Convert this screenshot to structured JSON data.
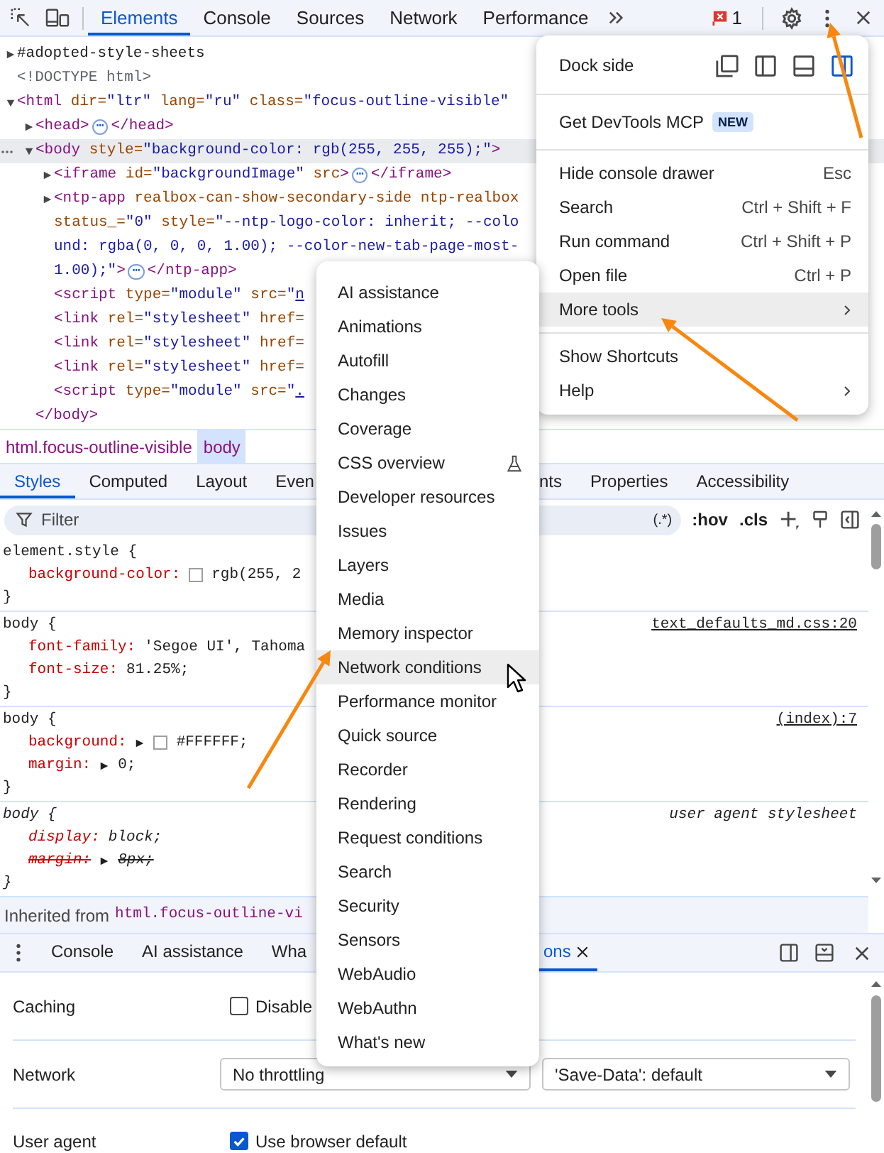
{
  "toolbar": {
    "tabs": [
      {
        "label": "Elements",
        "selected": true
      },
      {
        "label": "Console",
        "selected": false
      },
      {
        "label": "Sources",
        "selected": false
      },
      {
        "label": "Network",
        "selected": false
      },
      {
        "label": "Performance",
        "selected": false
      }
    ],
    "issues_count": "1"
  },
  "dom_tree": [
    {
      "lines": [
        [
          {
            "kind": "pseudo",
            "text": "#adopted-style-sheets"
          }
        ]
      ],
      "expanded": false,
      "selected": false
    },
    {
      "lines": [
        [
          {
            "kind": "doctype",
            "text": "<!DOCTYPE html>"
          }
        ]
      ],
      "selected": false
    },
    {
      "lines": [
        [
          {
            "kind": "tag",
            "text": "<html"
          },
          {
            "kind": "attr",
            "text": " dir="
          },
          {
            "kind": "value",
            "text": "\"ltr\""
          },
          {
            "kind": "attr",
            "text": " lang="
          },
          {
            "kind": "value",
            "text": "\"ru\""
          },
          {
            "kind": "attr",
            "text": " class="
          },
          {
            "kind": "value",
            "text": "\"focus-outline-visible\""
          }
        ]
      ],
      "expanded": true,
      "selected": false,
      "children": [
        {
          "lines": [
            [
              {
                "kind": "tag",
                "text": "<head>"
              },
              {
                "kind": "ellipsis",
                "text": "⋯"
              },
              {
                "kind": "tag",
                "text": "</head>"
              }
            ]
          ],
          "expanded": false,
          "selected": false
        },
        {
          "lines": [
            [
              {
                "kind": "tag",
                "text": "<body"
              },
              {
                "kind": "attr",
                "text": " style="
              },
              {
                "kind": "value",
                "text": "\"background-color: rgb(255, 255, 255);\""
              },
              {
                "kind": "tag",
                "text": ">"
              }
            ]
          ],
          "expanded": true,
          "selected": true,
          "children": [
            {
              "lines": [
                [
                  {
                    "kind": "tag",
                    "text": "<iframe"
                  },
                  {
                    "kind": "attr",
                    "text": " id="
                  },
                  {
                    "kind": "value",
                    "text": "\"backgroundImage\""
                  },
                  {
                    "kind": "attr",
                    "text": " src"
                  },
                  {
                    "kind": "tag",
                    "text": ">"
                  },
                  {
                    "kind": "ellipsis",
                    "text": "⋯"
                  },
                  {
                    "kind": "tag",
                    "text": "</iframe>"
                  }
                ]
              ],
              "expanded": false,
              "selected": false
            },
            {
              "lines": [
                [
                  {
                    "kind": "tag",
                    "text": "<ntp-app"
                  },
                  {
                    "kind": "attr",
                    "text": " realbox-can-show-secondary-side ntp-realbox"
                  }
                ],
                [
                  {
                    "kind": "attr",
                    "text": "status_="
                  },
                  {
                    "kind": "value",
                    "text": "\"0\""
                  },
                  {
                    "kind": "attr",
                    "text": " style="
                  },
                  {
                    "kind": "value",
                    "text": "\"--ntp-logo-color: inherit; --colo"
                  }
                ],
                [
                  {
                    "kind": "value",
                    "text": "und: rgba(0, 0, 0, 1.00); --color-new-tab-page-most-"
                  }
                ],
                [
                  {
                    "kind": "value",
                    "text": "1.00);\""
                  },
                  {
                    "kind": "tag",
                    "text": ">"
                  },
                  {
                    "kind": "ellipsis",
                    "text": "⋯"
                  },
                  {
                    "kind": "tag",
                    "text": "</ntp-app>"
                  }
                ]
              ],
              "expanded": false,
              "selected": false
            },
            {
              "lines": [
                [
                  {
                    "kind": "tag",
                    "text": "<script"
                  },
                  {
                    "kind": "attr",
                    "text": " type="
                  },
                  {
                    "kind": "value",
                    "text": "\"module\""
                  },
                  {
                    "kind": "attr",
                    "text": " src="
                  },
                  {
                    "kind": "value",
                    "text": "\""
                  },
                  {
                    "kind": "link",
                    "text": "n"
                  }
                ]
              ],
              "selected": false
            },
            {
              "lines": [
                [
                  {
                    "kind": "tag",
                    "text": "<link"
                  },
                  {
                    "kind": "attr",
                    "text": " rel="
                  },
                  {
                    "kind": "value",
                    "text": "\"stylesheet\""
                  },
                  {
                    "kind": "attr",
                    "text": " href="
                  }
                ]
              ],
              "selected": false
            },
            {
              "lines": [
                [
                  {
                    "kind": "tag",
                    "text": "<link"
                  },
                  {
                    "kind": "attr",
                    "text": " rel="
                  },
                  {
                    "kind": "value",
                    "text": "\"stylesheet\""
                  },
                  {
                    "kind": "attr",
                    "text": " href="
                  }
                ]
              ],
              "selected": false
            },
            {
              "lines": [
                [
                  {
                    "kind": "tag",
                    "text": "<link"
                  },
                  {
                    "kind": "attr",
                    "text": " rel="
                  },
                  {
                    "kind": "value",
                    "text": "\"stylesheet\""
                  },
                  {
                    "kind": "attr",
                    "text": " href="
                  }
                ]
              ],
              "selected": false
            },
            {
              "lines": [
                [
                  {
                    "kind": "tag",
                    "text": "<script"
                  },
                  {
                    "kind": "attr",
                    "text": " type="
                  },
                  {
                    "kind": "value",
                    "text": "\"module\""
                  },
                  {
                    "kind": "attr",
                    "text": " src="
                  },
                  {
                    "kind": "value",
                    "text": "\""
                  },
                  {
                    "kind": "link",
                    "text": "."
                  }
                ]
              ],
              "selected": false
            }
          ],
          "closing": [
            {
              "kind": "tag",
              "text": "</body>"
            }
          ]
        }
      ]
    }
  ],
  "breadcrumbs": [
    {
      "label": "html.focus-outline-visible",
      "selected": false
    },
    {
      "label": "body",
      "selected": true
    }
  ],
  "styles_tabs": [
    {
      "label": "Styles",
      "selected": true
    },
    {
      "label": "Computed",
      "selected": false
    },
    {
      "label": "Layout",
      "selected": false
    },
    {
      "label": "Even",
      "selected": false
    },
    {
      "label": "nts",
      "selected": false
    },
    {
      "label": "Properties",
      "selected": false
    },
    {
      "label": "Accessibility",
      "selected": false
    }
  ],
  "filter": {
    "placeholder": "Filter",
    "tools": [
      "(.*)",
      ":hov",
      ".cls"
    ]
  },
  "rules": [
    {
      "selector": "element.style {",
      "user_agent": false,
      "declarations": [
        {
          "name": "background-color:",
          "value": "rgb(255, 2",
          "swatch": true,
          "expandable": false,
          "struck": false
        }
      ],
      "closing": "}"
    },
    {
      "selector": "body {",
      "source": "text_defaults_md.css:20",
      "user_agent": false,
      "declarations": [
        {
          "name": "font-family:",
          "value": "'Segoe UI', Tahoma",
          "swatch": false,
          "expandable": false,
          "struck": false
        },
        {
          "name": "font-size:",
          "value": "81.25%;",
          "swatch": false,
          "expandable": false,
          "struck": false
        }
      ],
      "closing": "}"
    },
    {
      "selector": "body {",
      "source": "(index):7",
      "user_agent": false,
      "declarations": [
        {
          "name": "background:",
          "value": "#FFFFFF;",
          "swatch": true,
          "expandable": true,
          "struck": false
        },
        {
          "name": "margin:",
          "value": "0;",
          "swatch": false,
          "expandable": true,
          "struck": false
        }
      ],
      "closing": "}"
    },
    {
      "selector": "body {",
      "source": "user agent stylesheet",
      "user_agent": true,
      "declarations": [
        {
          "name": "display:",
          "value": "block;",
          "swatch": false,
          "expandable": false,
          "struck": false
        },
        {
          "name": "margin:",
          "value": "8px;",
          "swatch": false,
          "expandable": true,
          "struck": true
        }
      ],
      "closing": "}"
    }
  ],
  "inherited": {
    "label": "Inherited from",
    "selector": "html.focus-outline-vi"
  },
  "drawer_tabs": [
    {
      "label": "Console",
      "selected": false
    },
    {
      "label": "AI assistance",
      "selected": false
    },
    {
      "label": "Wha",
      "selected": false
    },
    {
      "label": "ons",
      "selected": true
    }
  ],
  "network_conditions": [
    {
      "kind": "checkbox",
      "label": "Caching",
      "checked": false,
      "text": "Disable"
    },
    {
      "kind": "selects",
      "label": "Network",
      "selects": [
        "No throttling",
        "'Save-Data': default"
      ]
    },
    {
      "kind": "checkbox",
      "label": "User agent",
      "checked": true,
      "text": "Use browser default"
    }
  ],
  "main_menu": [
    {
      "kind": "dock",
      "label": "Dock side",
      "options": [
        {
          "kind": "undock",
          "selected": false
        },
        {
          "kind": "left",
          "selected": false
        },
        {
          "kind": "bottom",
          "selected": false
        },
        {
          "kind": "right",
          "selected": true
        }
      ]
    },
    {
      "kind": "divider"
    },
    {
      "kind": "item",
      "label": "Get DevTools MCP",
      "badge": "NEW",
      "selected": false,
      "submenu": false
    },
    {
      "kind": "divider"
    },
    {
      "kind": "item",
      "label": "Hide console drawer",
      "shortcut": "Esc",
      "selected": false,
      "submenu": false
    },
    {
      "kind": "item",
      "label": "Search",
      "shortcut": "Ctrl + Shift + F",
      "selected": false,
      "submenu": false
    },
    {
      "kind": "item",
      "label": "Run command",
      "shortcut": "Ctrl + Shift + P",
      "selected": false,
      "submenu": false
    },
    {
      "kind": "item",
      "label": "Open file",
      "shortcut": "Ctrl + P",
      "selected": false,
      "submenu": false
    },
    {
      "kind": "item",
      "label": "More tools",
      "selected": true,
      "submenu": true
    },
    {
      "kind": "divider"
    },
    {
      "kind": "item",
      "label": "Show Shortcuts",
      "selected": false,
      "submenu": false
    },
    {
      "kind": "item",
      "label": "Help",
      "selected": false,
      "submenu": true
    }
  ],
  "more_tools_menu": [
    {
      "label": "AI assistance",
      "selected": false,
      "experimental": false
    },
    {
      "label": "Animations",
      "selected": false,
      "experimental": false
    },
    {
      "label": "Autofill",
      "selected": false,
      "experimental": false
    },
    {
      "label": "Changes",
      "selected": false,
      "experimental": false
    },
    {
      "label": "Coverage",
      "selected": false,
      "experimental": false
    },
    {
      "label": "CSS overview",
      "selected": false,
      "experimental": true
    },
    {
      "label": "Developer resources",
      "selected": false,
      "experimental": false
    },
    {
      "label": "Issues",
      "selected": false,
      "experimental": false
    },
    {
      "label": "Layers",
      "selected": false,
      "experimental": false
    },
    {
      "label": "Media",
      "selected": false,
      "experimental": false
    },
    {
      "label": "Memory inspector",
      "selected": false,
      "experimental": false
    },
    {
      "label": "Network conditions",
      "selected": true,
      "experimental": false
    },
    {
      "label": "Performance monitor",
      "selected": false,
      "experimental": false
    },
    {
      "label": "Quick source",
      "selected": false,
      "experimental": false
    },
    {
      "label": "Recorder",
      "selected": false,
      "experimental": false
    },
    {
      "label": "Rendering",
      "selected": false,
      "experimental": false
    },
    {
      "label": "Request conditions",
      "selected": false,
      "experimental": false
    },
    {
      "label": "Search",
      "selected": false,
      "experimental": false
    },
    {
      "label": "Security",
      "selected": false,
      "experimental": false
    },
    {
      "label": "Sensors",
      "selected": false,
      "experimental": false
    },
    {
      "label": "WebAudio",
      "selected": false,
      "experimental": false
    },
    {
      "label": "WebAuthn",
      "selected": false,
      "experimental": false
    },
    {
      "label": "What's new",
      "selected": false,
      "experimental": false
    }
  ]
}
